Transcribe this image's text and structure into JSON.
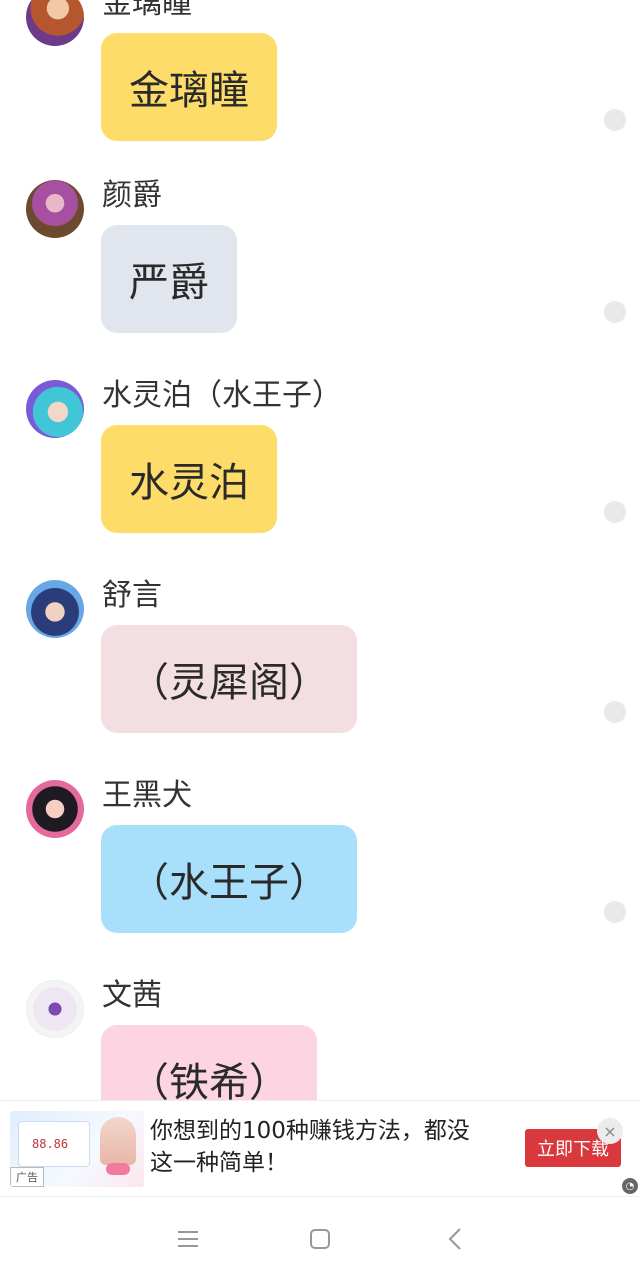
{
  "messages": [
    {
      "sender": "金璃瞳",
      "text": "金璃瞳",
      "bubble_color": "#fddc6a",
      "avatar_palette": [
        "#b5562e",
        "#6b3a8a"
      ]
    },
    {
      "sender": "颜爵",
      "text": "严爵",
      "bubble_color": "#e1e6ee",
      "avatar_palette": [
        "#6b4a2e",
        "#a74fa0"
      ]
    },
    {
      "sender": "水灵泊（水王子）",
      "text": "水灵泊",
      "bubble_color": "#fddc6a",
      "avatar_palette": [
        "#41c6d8",
        "#7b5ad8"
      ]
    },
    {
      "sender": "舒言",
      "text": "（灵犀阁）",
      "bubble_color": "#f3dfe1",
      "avatar_palette": [
        "#2a3d7a",
        "#67a7e6"
      ]
    },
    {
      "sender": "王黑犬",
      "text": "（水王子）",
      "bubble_color": "#a8e0fb",
      "avatar_palette": [
        "#1e1a22",
        "#e46a9c"
      ]
    },
    {
      "sender": "文茜",
      "text": "（铁希）",
      "bubble_color": "#fdd4e1",
      "avatar_palette": [
        "#f4f4f4",
        "#7a4ab0"
      ]
    }
  ],
  "ad": {
    "text": "你想到的100种赚钱方法，都没这一种简单！",
    "button": "立即下载",
    "badge": "广告",
    "image_amount": "88.86",
    "close_symbol": "×"
  },
  "nav": {
    "menu_icon": "menu-icon",
    "home_icon": "home-square-icon",
    "back_icon": "back-chevron-icon"
  }
}
